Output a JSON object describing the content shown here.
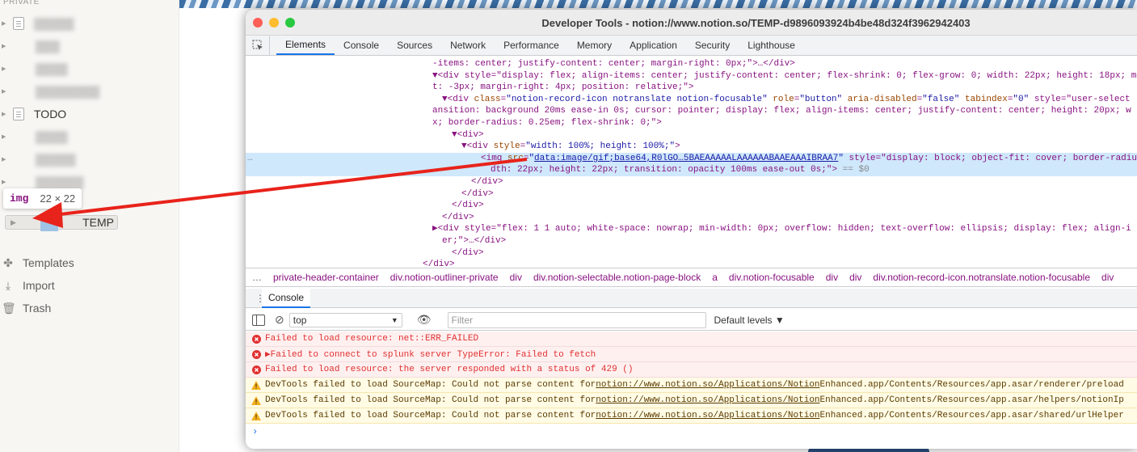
{
  "sidebar": {
    "section_label": "PRIVATE",
    "pages": [
      {
        "label": "▒▒▒▒▒",
        "blurred": true,
        "icon": "page-icon"
      },
      {
        "label": "▒▒▒",
        "blurred": true,
        "icon": "none"
      },
      {
        "label": "▒▒▒▒",
        "blurred": true,
        "icon": "none"
      },
      {
        "label": "▒▒▒▒▒▒▒▒",
        "blurred": true,
        "icon": "none"
      },
      {
        "label": "TODO",
        "blurred": false,
        "icon": "page-icon"
      },
      {
        "label": "▒▒▒▒",
        "blurred": true,
        "icon": "none"
      },
      {
        "label": "▒▒▒▒▒",
        "blurred": true,
        "icon": "none"
      },
      {
        "label": "▒▒▒▒▒▒",
        "blurred": true,
        "icon": "none"
      }
    ],
    "temp_label": "TEMP",
    "bottom": [
      {
        "label": "Templates",
        "icon": "templates-icon"
      },
      {
        "label": "Import",
        "icon": "import-icon"
      },
      {
        "label": "Trash",
        "icon": "trash-icon"
      }
    ]
  },
  "tooltip": {
    "tag": "img",
    "size": "22 × 22"
  },
  "devtools": {
    "title": "Developer Tools - notion://www.notion.so/TEMP-d9896093924b4be48d324f3962942403",
    "tabs": [
      "Elements",
      "Console",
      "Sources",
      "Network",
      "Performance",
      "Memory",
      "Application",
      "Security",
      "Lighthouse"
    ],
    "active_tab": "Elements",
    "code_lines": [
      "-items: center; justify-content: center; margin-right: 0px;\">…</div>",
      "▼<div style=\"display: flex; align-items: center; justify-content: center; flex-shrink: 0; flex-grow: 0; width: 22px; height: 18px; ma",
      "t: -3px; margin-right: 4px; position: relative;\">",
      "▼<div class=\"notion-record-icon notranslate notion-focusable\" role=\"button\" aria-disabled=\"false\" tabindex=\"0\" style=\"user-select",
      "ansition: background 20ms ease-in 0s; cursor: pointer; display: flex; align-items: center; justify-content: center; height: 20px; w",
      "x; border-radius: 0.25em; flex-shrink: 0;\">",
      "▼<div>",
      "▼<div style=\"width: 100%; height: 100%;\">",
      "<img src=\"data:image/gif;base64,R0lGO…5BAEAAAAALAAAAAABAAEAAAIBRAA7\" style=\"display: block; object-fit: cover; border-radiu",
      "dth: 22px; height: 22px; transition: opacity 100ms ease-out 0s;\"> == $0",
      "</div>",
      "</div>",
      "</div>",
      "</div>",
      "▶<div style=\"flex: 1 1 auto; white-space: nowrap; min-width: 0px; overflow: hidden; text-overflow: ellipsis; display: flex; align-i",
      "er;\">…</div>",
      "</div>",
      "</div>"
    ],
    "highlight_prefix": "…",
    "breadcrumbs": [
      "…",
      "private-header-container",
      "div.notion-outliner-private",
      "div",
      "div.notion-selectable.notion-page-block",
      "a",
      "div.notion-focusable",
      "div",
      "div",
      "div.notion-record-icon.notranslate.notion-focusable",
      "div"
    ],
    "console_tab": "Console",
    "context": "top",
    "filter_placeholder": "Filter",
    "levels": "Default levels ▼",
    "messages": [
      {
        "type": "error",
        "text": "Failed to load resource: net::ERR_FAILED",
        "link": "",
        "rest": ""
      },
      {
        "type": "error",
        "text": "▶Failed to connect to splunk server TypeError: Failed to fetch",
        "link": "",
        "rest": ""
      },
      {
        "type": "error",
        "text": "Failed to load resource: the server responded with a status of 429 ()",
        "link": "",
        "rest": ""
      },
      {
        "type": "warning",
        "text": "DevTools failed to load SourceMap: Could not parse content for ",
        "link": "notion://www.notion.so/Applications/Notion",
        "rest": " Enhanced.app/Contents/Resources/app.asar/renderer/preload"
      },
      {
        "type": "warning",
        "text": "DevTools failed to load SourceMap: Could not parse content for ",
        "link": "notion://www.notion.so/Applications/Notion",
        "rest": " Enhanced.app/Contents/Resources/app.asar/helpers/notionIp"
      },
      {
        "type": "warning",
        "text": "DevTools failed to load SourceMap: Could not parse content for ",
        "link": "notion://www.notion.so/Applications/Notion",
        "rest": " Enhanced.app/Contents/Resources/app.asar/shared/urlHelper"
      }
    ],
    "prompt": "›"
  },
  "colors": {
    "error": "#e03030",
    "warning": "#5c3c00",
    "arrow": "#e8231b",
    "accent": "#1a73e8"
  }
}
